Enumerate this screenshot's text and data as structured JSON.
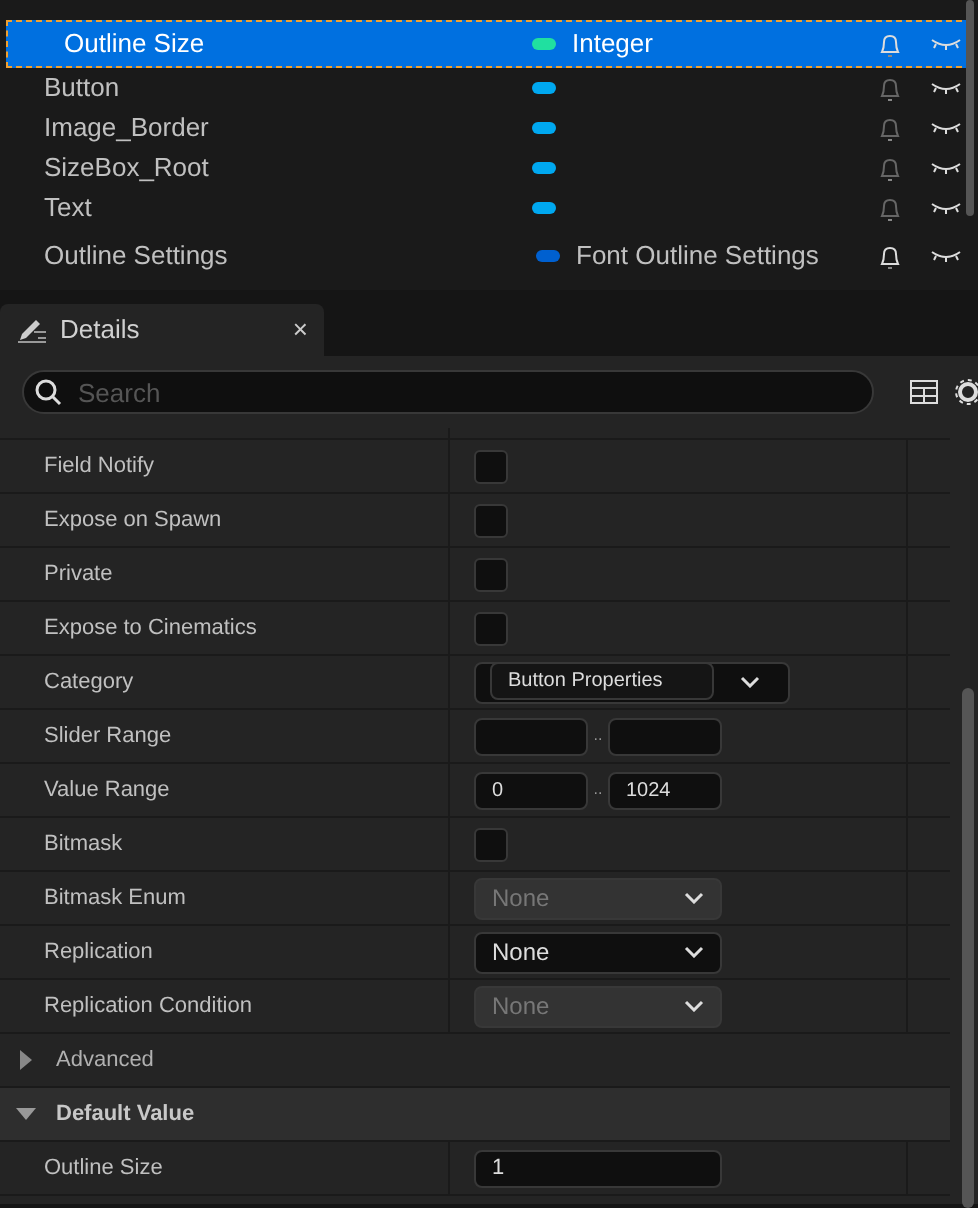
{
  "variables": [
    {
      "name": "Outline Size",
      "type": "Integer",
      "kind": "member",
      "color": "#20e0a0",
      "selected": true
    },
    {
      "name": "Button",
      "kind": "variable",
      "color": "#00a8f0",
      "selected": false
    },
    {
      "name": "Image_Border",
      "kind": "variable",
      "color": "#00a8f0",
      "selected": false
    },
    {
      "name": "SizeBox_Root",
      "kind": "variable",
      "color": "#00a8f0",
      "selected": false
    },
    {
      "name": "Text",
      "kind": "variable",
      "color": "#00a8f0",
      "selected": false
    },
    {
      "name": "Outline Settings",
      "type": "Font Outline Settings",
      "kind": "variable",
      "color": "#0060d0",
      "selected": false
    }
  ],
  "details": {
    "tab": {
      "title": "Details",
      "close": "×"
    },
    "search": {
      "placeholder": "Search"
    },
    "rows": [
      {
        "kind": "checkbox",
        "label": "Field Notify",
        "checked": false
      },
      {
        "kind": "checkbox",
        "label": "Expose on Spawn",
        "checked": false
      },
      {
        "kind": "checkbox",
        "label": "Private",
        "checked": false
      },
      {
        "kind": "checkbox",
        "label": "Expose to Cinematics",
        "checked": false
      },
      {
        "kind": "combo",
        "label": "Category",
        "value": "Button Properties"
      },
      {
        "kind": "range",
        "label": "Slider Range",
        "separator": "..",
        "min": "",
        "max": ""
      },
      {
        "kind": "range",
        "label": "Value Range",
        "separator": "..",
        "min": "0",
        "max": "1024"
      },
      {
        "kind": "checkbox",
        "label": "Bitmask",
        "checked": false
      },
      {
        "kind": "dropdown",
        "label": "Bitmask Enum",
        "value": "None",
        "disabled": true
      },
      {
        "kind": "dropdown",
        "label": "Replication",
        "value": "None",
        "disabled": false
      },
      {
        "kind": "dropdown",
        "label": "Replication Condition",
        "value": "None",
        "disabled": true
      },
      {
        "kind": "section",
        "label": "Advanced",
        "expanded": false
      },
      {
        "kind": "section",
        "label": "Default Value",
        "expanded": true
      },
      {
        "kind": "text",
        "label": "Outline Size",
        "value": "1"
      }
    ]
  }
}
